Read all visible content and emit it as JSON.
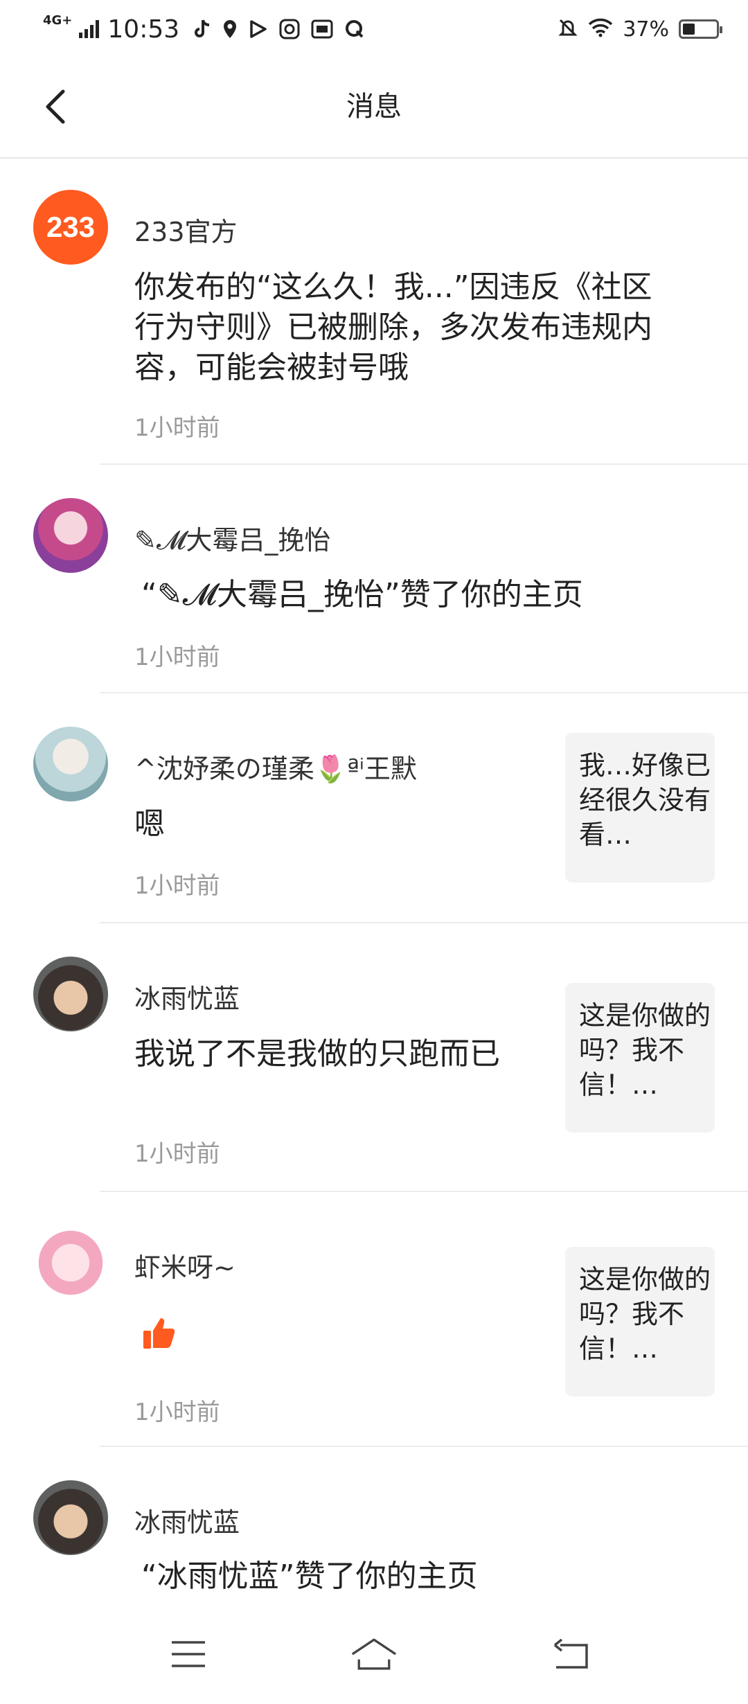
{
  "status_bar": {
    "network": "4G+",
    "time": "10:53",
    "battery_percent": "37%",
    "battery_level": 0.37,
    "icons": [
      "tiktok-icon",
      "location-icon",
      "play-icon",
      "app-icon",
      "iqiyi-icon",
      "q-icon"
    ]
  },
  "header": {
    "title": "消息"
  },
  "messages": [
    {
      "name": "233官方",
      "text": "你发布的“这么久！我...”因违反《社区行为守则》已被删除，多次发布违规内容，可能会被封号哦",
      "time": "1小时前",
      "avatar_text": "233"
    },
    {
      "name": "✎𝓜大霉吕_挽怡",
      "text": "“✎𝓜大霉吕_挽怡”赞了你的主页",
      "time": "1小时前"
    },
    {
      "name": "^沈妤柔の瑾柔🌷ªⁱ王默",
      "text": "嗯",
      "time": "1小时前",
      "thumb": "我…好像已经很久没有看…"
    },
    {
      "name": "冰雨忧蓝",
      "text": "我说了不是我做的只跑而已",
      "time": "1小时前",
      "thumb": "这是你做的吗？我不信！…"
    },
    {
      "name": "虾米呀~",
      "text": "",
      "time": "1小时前",
      "thumb": "这是你做的吗？我不信！…",
      "icon": "thumbs-up-icon"
    },
    {
      "name": "冰雨忧蓝",
      "text": "“冰雨忧蓝”赞了你的主页",
      "time": ""
    }
  ],
  "colors": {
    "accent": "#ff5a1f",
    "like": "#ff5a1f"
  }
}
